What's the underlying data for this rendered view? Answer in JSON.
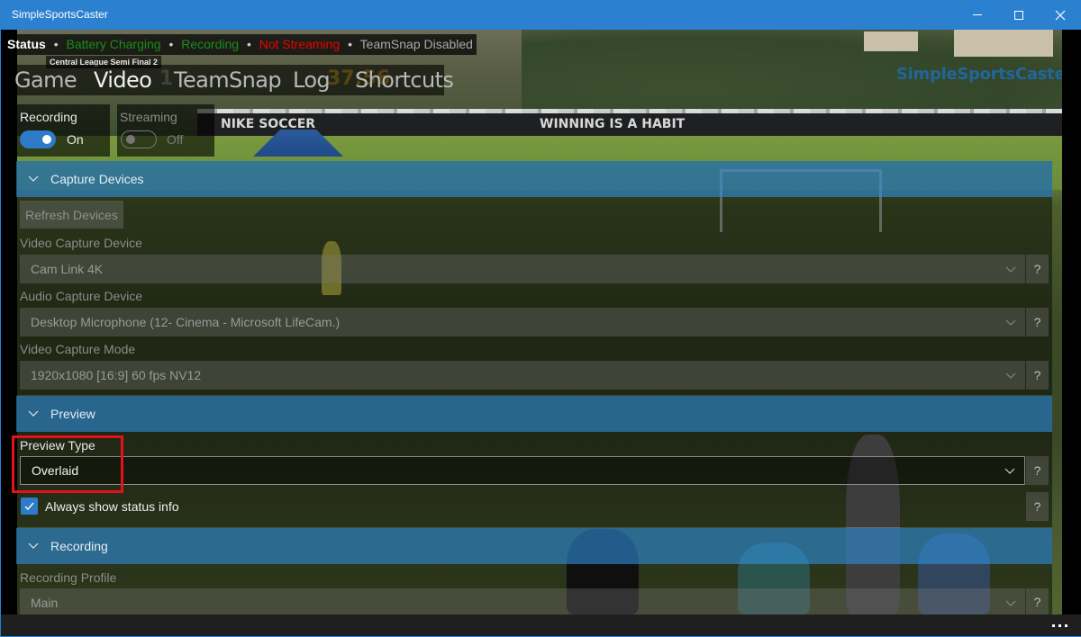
{
  "window": {
    "title": "SimpleSportsCaster",
    "minimize_icon": "minimize-icon",
    "maximize_icon": "maximize-icon",
    "close_icon": "close-icon"
  },
  "background": {
    "logo_text": "SimpleSportsCaster",
    "fence_text_1": "NIKE SOCCER",
    "fence_text_2": "WINNING IS A HABIT"
  },
  "status": {
    "label": "Status",
    "separator": "•",
    "items": [
      {
        "text": "Battery Charging",
        "color": "#1a8c1a"
      },
      {
        "text": "Recording",
        "color": "#1a8c1a"
      },
      {
        "text": "Not Streaming",
        "color": "#e00000"
      },
      {
        "text": "TeamSnap Disabled",
        "color": "#a8a8a8"
      }
    ]
  },
  "scoreboard": {
    "title": "Central League Semi Final 2",
    "ghost_score": "1",
    "ghost_clock": "37:56"
  },
  "nav": {
    "tabs": [
      {
        "label": "Game",
        "active": false
      },
      {
        "label": "Video",
        "active": true
      },
      {
        "label": "TeamSnap",
        "active": false
      },
      {
        "label": "Log",
        "active": false
      },
      {
        "label": "Shortcuts",
        "active": false
      }
    ]
  },
  "toggles": {
    "recording": {
      "label": "Recording",
      "state": "On",
      "on": true
    },
    "streaming": {
      "label": "Streaming",
      "state": "Off",
      "on": false
    }
  },
  "sections": {
    "capture": {
      "title": "Capture Devices",
      "refresh_label": "Refresh Devices",
      "video_device_label": "Video Capture Device",
      "video_device_value": "Cam Link 4K",
      "audio_device_label": "Audio Capture Device",
      "audio_device_value": "Desktop Microphone (12- Cinema - Microsoft LifeCam.)",
      "video_mode_label": "Video Capture Mode",
      "video_mode_value": "1920x1080 [16:9] 60 fps NV12"
    },
    "preview": {
      "title": "Preview",
      "type_label": "Preview Type",
      "type_value": "Overlaid",
      "always_status_label": "Always show status info",
      "always_status_checked": true
    },
    "recording": {
      "title": "Recording",
      "profile_label": "Recording Profile",
      "profile_value": "Main"
    }
  },
  "help_label": "?",
  "accent_color": "#2b80cf",
  "highlight_color": "#e8101a",
  "more_icon": "more-icon"
}
